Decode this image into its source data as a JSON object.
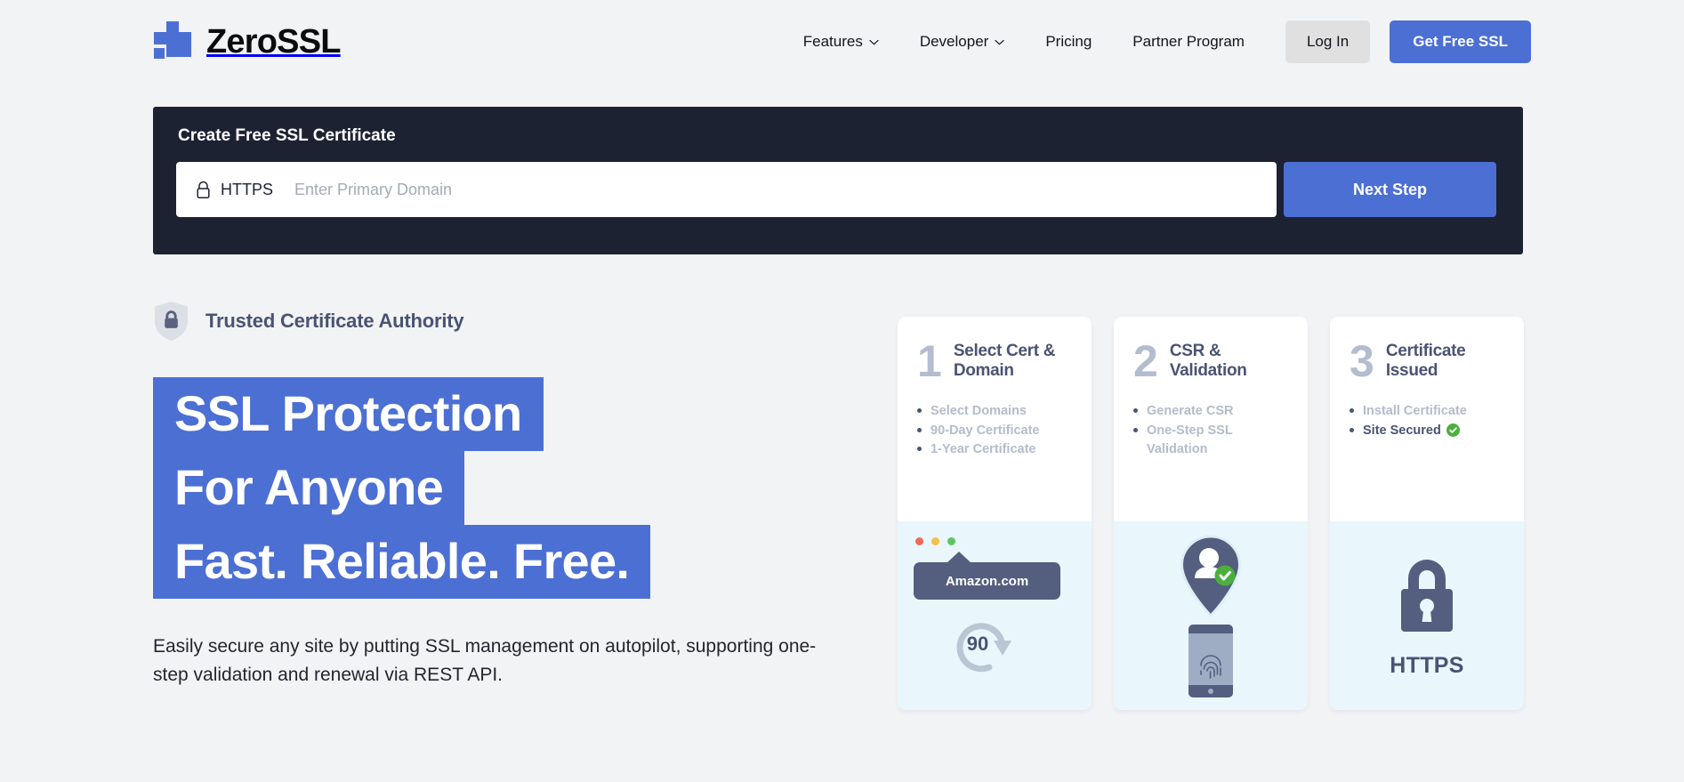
{
  "brand": {
    "name": "ZeroSSL",
    "logo_icon": "puzzle-piece-icon",
    "accent_color": "#4c6fd4"
  },
  "nav": {
    "links": [
      {
        "label": "Features",
        "has_dropdown": true,
        "icon": "chevron-down-icon"
      },
      {
        "label": "Developer",
        "has_dropdown": true,
        "icon": "chevron-down-icon"
      },
      {
        "label": "Pricing",
        "has_dropdown": false
      },
      {
        "label": "Partner Program",
        "has_dropdown": false
      }
    ],
    "login_label": "Log In",
    "cta_label": "Get Free SSL"
  },
  "form": {
    "title": "Create Free SSL Certificate",
    "protocol_label": "HTTPS",
    "lock_icon": "lock-outline-icon",
    "domain_placeholder": "Enter Primary Domain",
    "domain_value": "",
    "next_label": "Next Step"
  },
  "hero": {
    "trust_icon": "shield-lock-icon",
    "trust_label": "Trusted Certificate Authority",
    "headline_lines": [
      "SSL Protection",
      "For Anyone",
      "Fast. Reliable. Free."
    ],
    "paragraph": "Easily secure any site by putting SSL management on autopilot, supporting one-step validation and renewal via REST API."
  },
  "steps": [
    {
      "number": "1",
      "title": "Select Cert & Domain",
      "bullets": [
        {
          "text": "Select Domains",
          "strong": false,
          "check": false
        },
        {
          "text": "90-Day Certificate",
          "strong": false,
          "check": false
        },
        {
          "text": "1-Year Certificate",
          "strong": false,
          "check": false
        }
      ],
      "illustration": {
        "type": "browser-tooltip",
        "traffic_dots": [
          "#f0695a",
          "#f5bf4c",
          "#5cc462"
        ],
        "tooltip_text": "Amazon.com",
        "renewal_days": "90",
        "renewal_icon": "circular-arrow-icon"
      }
    },
    {
      "number": "2",
      "title": "CSR & Validation",
      "bullets": [
        {
          "text": "Generate CSR",
          "strong": false,
          "check": false
        },
        {
          "text": "One-Step SSL Validation",
          "strong": false,
          "check": false
        }
      ],
      "illustration": {
        "type": "identity-verify",
        "pin_icon": "map-pin-person-icon",
        "verified_icon": "green-check-icon",
        "phone_icon": "phone-fingerprint-icon"
      }
    },
    {
      "number": "3",
      "title": "Certificate Issued",
      "bullets": [
        {
          "text": "Install Certificate",
          "strong": false,
          "check": false
        },
        {
          "text": "Site Secured",
          "strong": true,
          "check": true
        }
      ],
      "illustration": {
        "type": "padlock",
        "padlock_icon": "padlock-solid-icon",
        "caption": "HTTPS"
      }
    }
  ],
  "colors": {
    "page_bg": "#f2f3f5",
    "panel_dark": "#1d2233",
    "accent": "#4c6fd4",
    "slate": "#4a5372",
    "muted": "#b4bcca",
    "card_illus_bg": "#e9f7fd",
    "green": "#4caf3d"
  }
}
